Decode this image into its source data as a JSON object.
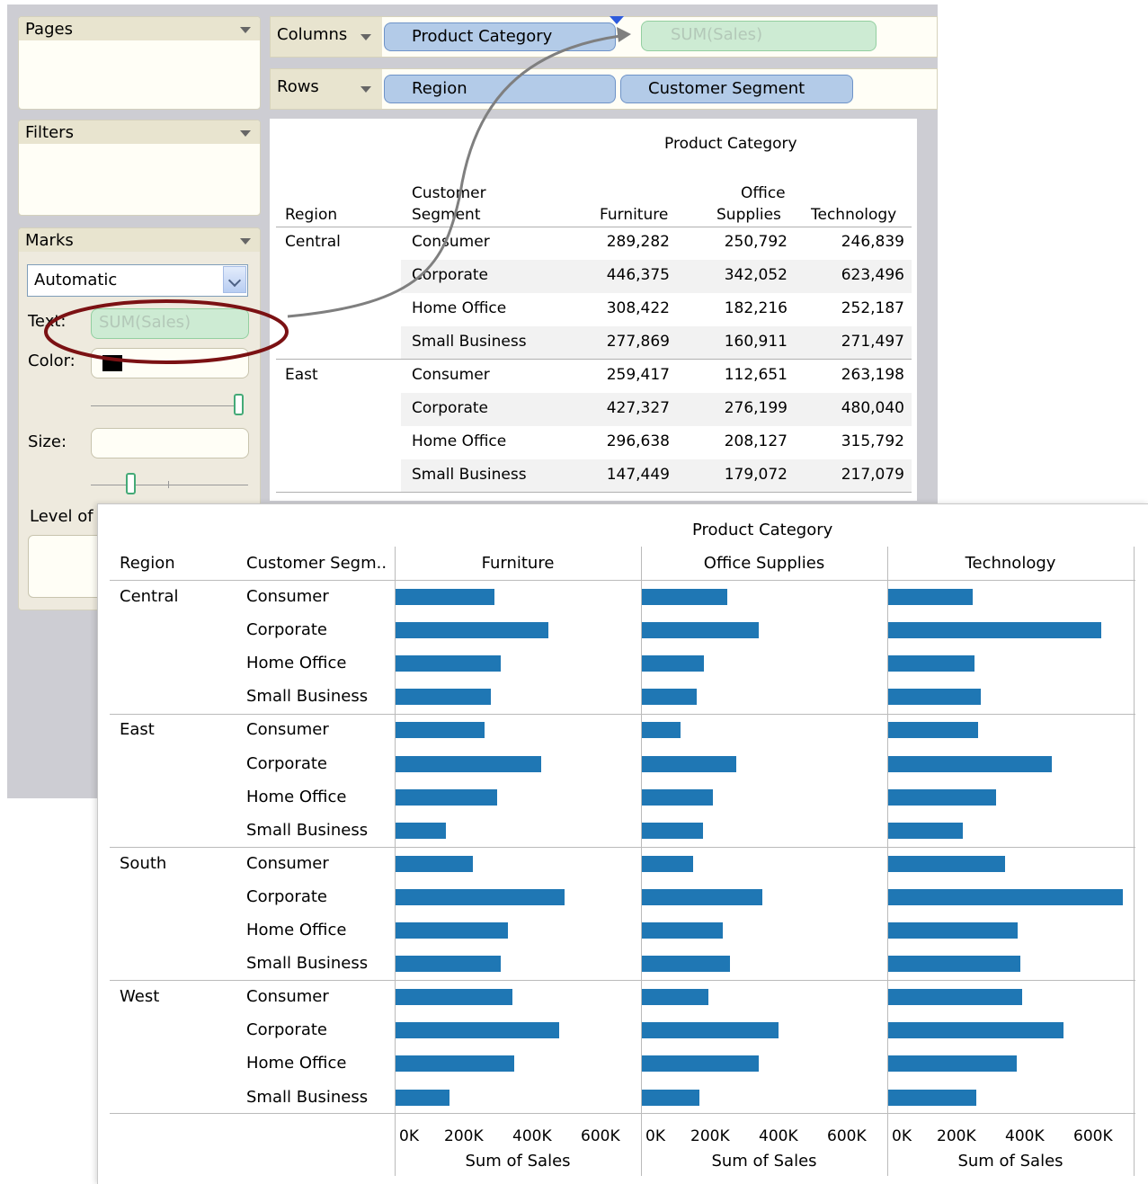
{
  "cards": {
    "pages_title": "Pages",
    "filters_title": "Filters",
    "marks_title": "Marks",
    "mark_type": "Automatic",
    "text_label": "Text:",
    "text_pill": "SUM(Sales)",
    "color_label": "Color:",
    "size_label": "Size:",
    "level_label": "Level of"
  },
  "shelves": {
    "columns_label": "Columns",
    "columns_pills": [
      "Product Category",
      "SUM(Sales)"
    ],
    "rows_label": "Rows",
    "rows_pills": [
      "Region",
      "Customer Segment"
    ]
  },
  "crosstab": {
    "column_group": "Product Category",
    "header_region": "Region",
    "header_segment": "Customer Segment",
    "header_segment_lines": [
      "Customer",
      "Segment"
    ],
    "categories": [
      "Furniture",
      "Office Supplies",
      "Technology"
    ],
    "office_lines": [
      "Office",
      "Supplies"
    ],
    "rows": [
      {
        "region": "Central",
        "segment": "Consumer",
        "values": [
          "289,282",
          "250,792",
          "246,839"
        ]
      },
      {
        "region": "",
        "segment": "Corporate",
        "values": [
          "446,375",
          "342,052",
          "623,496"
        ]
      },
      {
        "region": "",
        "segment": "Home Office",
        "values": [
          "308,422",
          "182,216",
          "252,187"
        ]
      },
      {
        "region": "",
        "segment": "Small Business",
        "values": [
          "277,869",
          "160,911",
          "271,497"
        ]
      },
      {
        "region": "East",
        "segment": "Consumer",
        "values": [
          "259,417",
          "112,651",
          "263,198"
        ]
      },
      {
        "region": "",
        "segment": "Corporate",
        "values": [
          "427,327",
          "276,199",
          "480,040"
        ]
      },
      {
        "region": "",
        "segment": "Home Office",
        "values": [
          "296,638",
          "208,127",
          "315,792"
        ]
      },
      {
        "region": "",
        "segment": "Small Business",
        "values": [
          "147,449",
          "179,072",
          "217,079"
        ]
      }
    ]
  },
  "chart_data": {
    "type": "bar",
    "orientation": "horizontal",
    "title": "Product Category",
    "row_headers": [
      "Region",
      "Customer Segm.."
    ],
    "panels": [
      "Furniture",
      "Office Supplies",
      "Technology"
    ],
    "regions": [
      "Central",
      "East",
      "South",
      "West"
    ],
    "segments": [
      "Consumer",
      "Corporate",
      "Home Office",
      "Small Business"
    ],
    "xlabel": "Sum of Sales",
    "xlim": [
      0,
      700000
    ],
    "xticks": [
      "0K",
      "200K",
      "400K",
      "600K"
    ],
    "xtick_values": [
      0,
      200000,
      400000,
      600000
    ],
    "bar_color": "#1f77b4",
    "values": {
      "Central": {
        "Furniture": [
          289282,
          446375,
          308422,
          277869
        ],
        "Office Supplies": [
          250792,
          342052,
          182216,
          160911
        ],
        "Technology": [
          246839,
          623496,
          252187,
          271497
        ]
      },
      "East": {
        "Furniture": [
          259417,
          427327,
          296638,
          147449
        ],
        "Office Supplies": [
          112651,
          276199,
          208127,
          179072
        ],
        "Technology": [
          263198,
          480040,
          315792,
          217079
        ]
      },
      "South": {
        "Furniture": [
          225000,
          495000,
          330000,
          308000
        ],
        "Office Supplies": [
          150000,
          352000,
          236000,
          259000
        ],
        "Technology": [
          342000,
          688000,
          380000,
          388000
        ]
      },
      "West": {
        "Furniture": [
          342000,
          478000,
          348000,
          159000
        ],
        "Office Supplies": [
          195000,
          399000,
          342000,
          167000
        ],
        "Technology": [
          393000,
          513000,
          377000,
          257000
        ]
      }
    }
  }
}
